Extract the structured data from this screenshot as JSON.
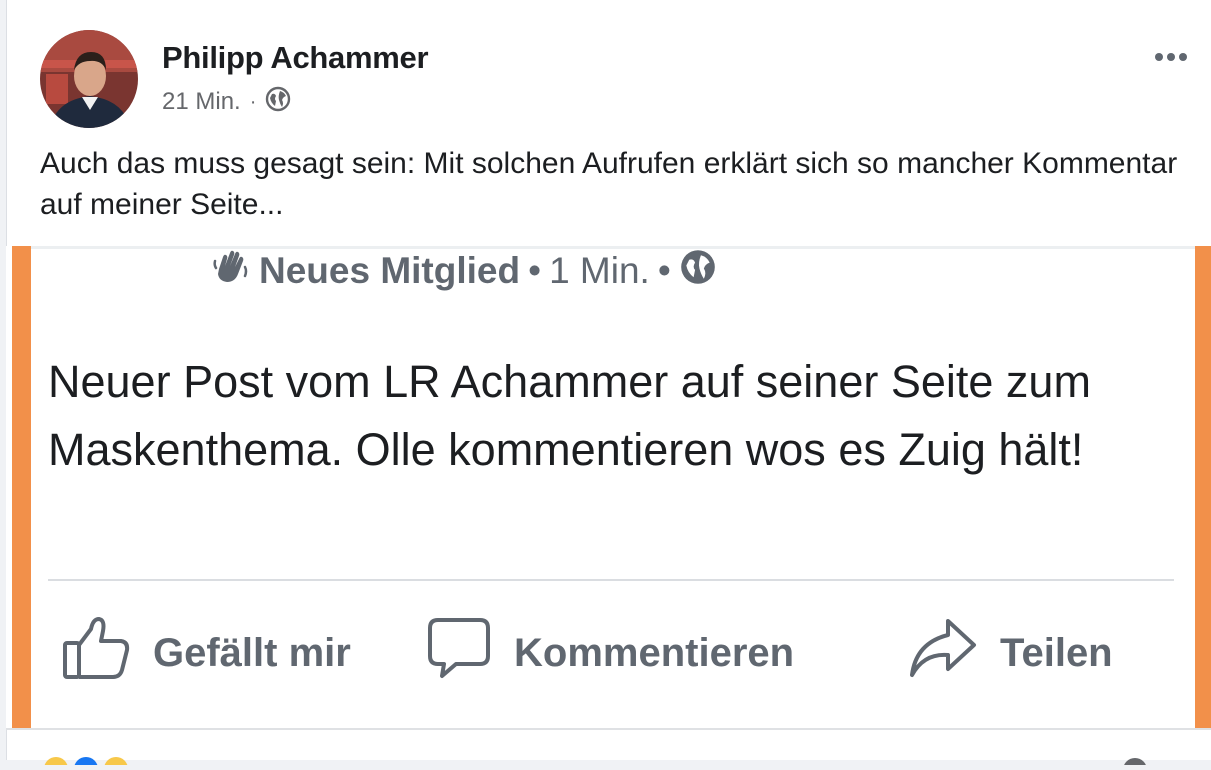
{
  "post": {
    "author": "Philipp Achammer",
    "time": "21 Min.",
    "separator": "·",
    "text": "Auch das muss gesagt sein: Mit solchen Aufrufen erklärt sich so mancher Kommentar auf meiner Seite..."
  },
  "shared": {
    "author": "Neues Mitglied",
    "separator": "•",
    "time": "1 Min.",
    "text": "Neuer Post vom LR Achammer auf seiner Seite zum Maskenthema. Olle kommentieren wos es Zuig hält!",
    "actions": {
      "like": "Gefällt mir",
      "comment": "Kommentieren",
      "share": "Teilen"
    }
  },
  "icons": {
    "audience": "globe-icon",
    "new_member_badge": "waving-hand-icon",
    "more": "more-options-icon",
    "like": "thumbs-up-icon",
    "comment": "comment-bubble-icon",
    "share": "share-arrow-icon"
  },
  "colors": {
    "accent_frame": "#f2904a",
    "text_primary": "#1c1e21",
    "text_secondary": "#65676b"
  }
}
